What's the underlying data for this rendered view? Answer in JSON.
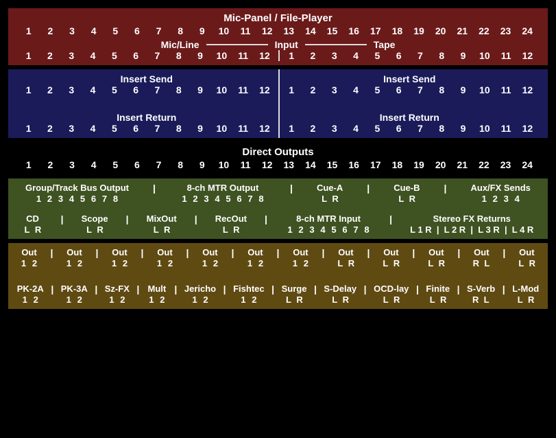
{
  "red": {
    "title": "Mic-Panel / File-Player",
    "nums24": [
      "1",
      "2",
      "3",
      "4",
      "5",
      "6",
      "7",
      "8",
      "9",
      "10",
      "11",
      "12",
      "13",
      "14",
      "15",
      "16",
      "17",
      "18",
      "19",
      "20",
      "21",
      "22",
      "23",
      "24"
    ],
    "labels": {
      "left": "Mic/Line",
      "center": "Input",
      "right": "Tape"
    },
    "left12": [
      "1",
      "2",
      "3",
      "4",
      "5",
      "6",
      "7",
      "8",
      "9",
      "10",
      "11",
      "12"
    ],
    "right12": [
      "1",
      "2",
      "3",
      "4",
      "5",
      "6",
      "7",
      "8",
      "9",
      "10",
      "11",
      "12"
    ]
  },
  "navy": {
    "send_label": "Insert Send",
    "ret_label": "Insert Return",
    "nums12": [
      "1",
      "2",
      "3",
      "4",
      "5",
      "6",
      "7",
      "8",
      "9",
      "10",
      "11",
      "12"
    ]
  },
  "black": {
    "title": "Direct Outputs",
    "nums24": [
      "1",
      "2",
      "3",
      "4",
      "5",
      "6",
      "7",
      "8",
      "9",
      "10",
      "11",
      "12",
      "13",
      "14",
      "15",
      "16",
      "17",
      "18",
      "19",
      "20",
      "21",
      "22",
      "23",
      "24"
    ]
  },
  "olive": {
    "row1": [
      {
        "h": "Group/Track Bus Output",
        "v": [
          "1",
          "2",
          "3",
          "4",
          "5",
          "6",
          "7",
          "8"
        ]
      },
      {
        "h": "8-ch MTR Output",
        "v": [
          "1",
          "2",
          "3",
          "4",
          "5",
          "6",
          "7",
          "8"
        ]
      },
      {
        "h": "Cue-A",
        "v": [
          "L",
          "R"
        ]
      },
      {
        "h": "Cue-B",
        "v": [
          "L",
          "R"
        ]
      },
      {
        "h": "Aux/FX Sends",
        "v": [
          "1",
          "2",
          "3",
          "4"
        ]
      }
    ],
    "row2": [
      {
        "h": "CD",
        "v": [
          "L",
          "R"
        ]
      },
      {
        "h": "Scope",
        "v": [
          "L",
          "R"
        ]
      },
      {
        "h": "MixOut",
        "v": [
          "L",
          "R"
        ]
      },
      {
        "h": "RecOut",
        "v": [
          "L",
          "R"
        ]
      },
      {
        "h": "8-ch MTR Input",
        "v": [
          "1",
          "2",
          "3",
          "4",
          "5",
          "6",
          "7",
          "8"
        ]
      },
      {
        "h": "Stereo FX Returns",
        "v": [
          "L 1 R",
          "L 2 R",
          "L 3 R",
          "L 4 R"
        ]
      }
    ]
  },
  "brown": {
    "row1": [
      {
        "h": "Out",
        "v": [
          "1",
          "2"
        ]
      },
      {
        "h": "Out",
        "v": [
          "1",
          "2"
        ]
      },
      {
        "h": "Out",
        "v": [
          "1",
          "2"
        ]
      },
      {
        "h": "Out",
        "v": [
          "1",
          "2"
        ]
      },
      {
        "h": "Out",
        "v": [
          "1",
          "2"
        ]
      },
      {
        "h": "Out",
        "v": [
          "1",
          "2"
        ]
      },
      {
        "h": "Out",
        "v": [
          "1",
          "2"
        ]
      },
      {
        "h": "Out",
        "v": [
          "L",
          "R"
        ]
      },
      {
        "h": "Out",
        "v": [
          "L",
          "R"
        ]
      },
      {
        "h": "Out",
        "v": [
          "L",
          "R"
        ]
      },
      {
        "h": "Out",
        "v": [
          "R",
          "L"
        ]
      },
      {
        "h": "Out",
        "v": [
          "L",
          "R"
        ]
      }
    ],
    "row2": [
      {
        "h": "PK-2A",
        "v": [
          "1",
          "2"
        ]
      },
      {
        "h": "PK-3A",
        "v": [
          "1",
          "2"
        ]
      },
      {
        "h": "Sz-FX",
        "v": [
          "1",
          "2"
        ]
      },
      {
        "h": "Mult",
        "v": [
          "1",
          "2"
        ]
      },
      {
        "h": "Jericho",
        "v": [
          "1",
          "2"
        ]
      },
      {
        "h": "Fishtec",
        "v": [
          "1",
          "2"
        ]
      },
      {
        "h": "Surge",
        "v": [
          "L",
          "R"
        ]
      },
      {
        "h": "S-Delay",
        "v": [
          "L",
          "R"
        ]
      },
      {
        "h": "OCD-lay",
        "v": [
          "L",
          "R"
        ]
      },
      {
        "h": "Finite",
        "v": [
          "L",
          "R"
        ]
      },
      {
        "h": "S-Verb",
        "v": [
          "R",
          "L"
        ]
      },
      {
        "h": "L-Mod",
        "v": [
          "L",
          "R"
        ]
      }
    ]
  }
}
